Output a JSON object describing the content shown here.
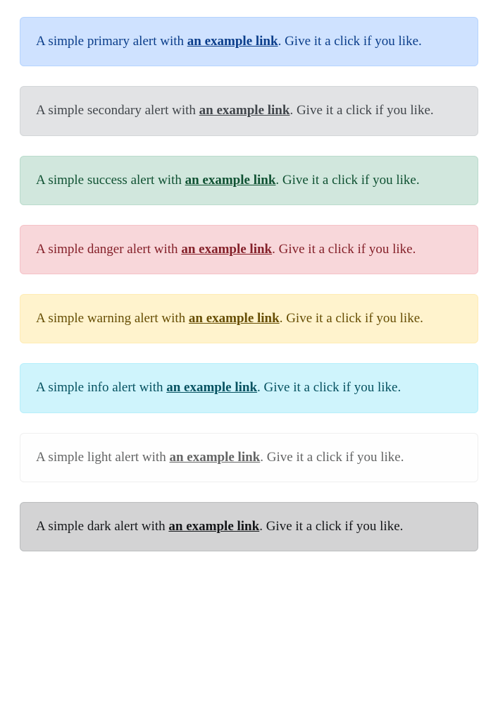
{
  "alerts": [
    {
      "variant": "primary",
      "pre": "A simple primary alert with ",
      "link": "an example link",
      "post": ". Give it a click if you like."
    },
    {
      "variant": "secondary",
      "pre": "A simple secondary alert with ",
      "link": "an example link",
      "post": ". Give it a click if you like."
    },
    {
      "variant": "success",
      "pre": "A simple success alert with ",
      "link": "an example link",
      "post": ". Give it a click if you like."
    },
    {
      "variant": "danger",
      "pre": "A simple danger alert with ",
      "link": "an example link",
      "post": ". Give it a click if you like."
    },
    {
      "variant": "warning",
      "pre": "A simple warning alert with ",
      "link": "an example link",
      "post": ". Give it a click if you like."
    },
    {
      "variant": "info",
      "pre": "A simple info alert with ",
      "link": "an example link",
      "post": ". Give it a click if you like."
    },
    {
      "variant": "light",
      "pre": "A simple light alert with ",
      "link": "an example link",
      "post": ". Give it a click if you like."
    },
    {
      "variant": "dark",
      "pre": "A simple dark alert with ",
      "link": "an example link",
      "post": ". Give it a click if you like."
    }
  ]
}
